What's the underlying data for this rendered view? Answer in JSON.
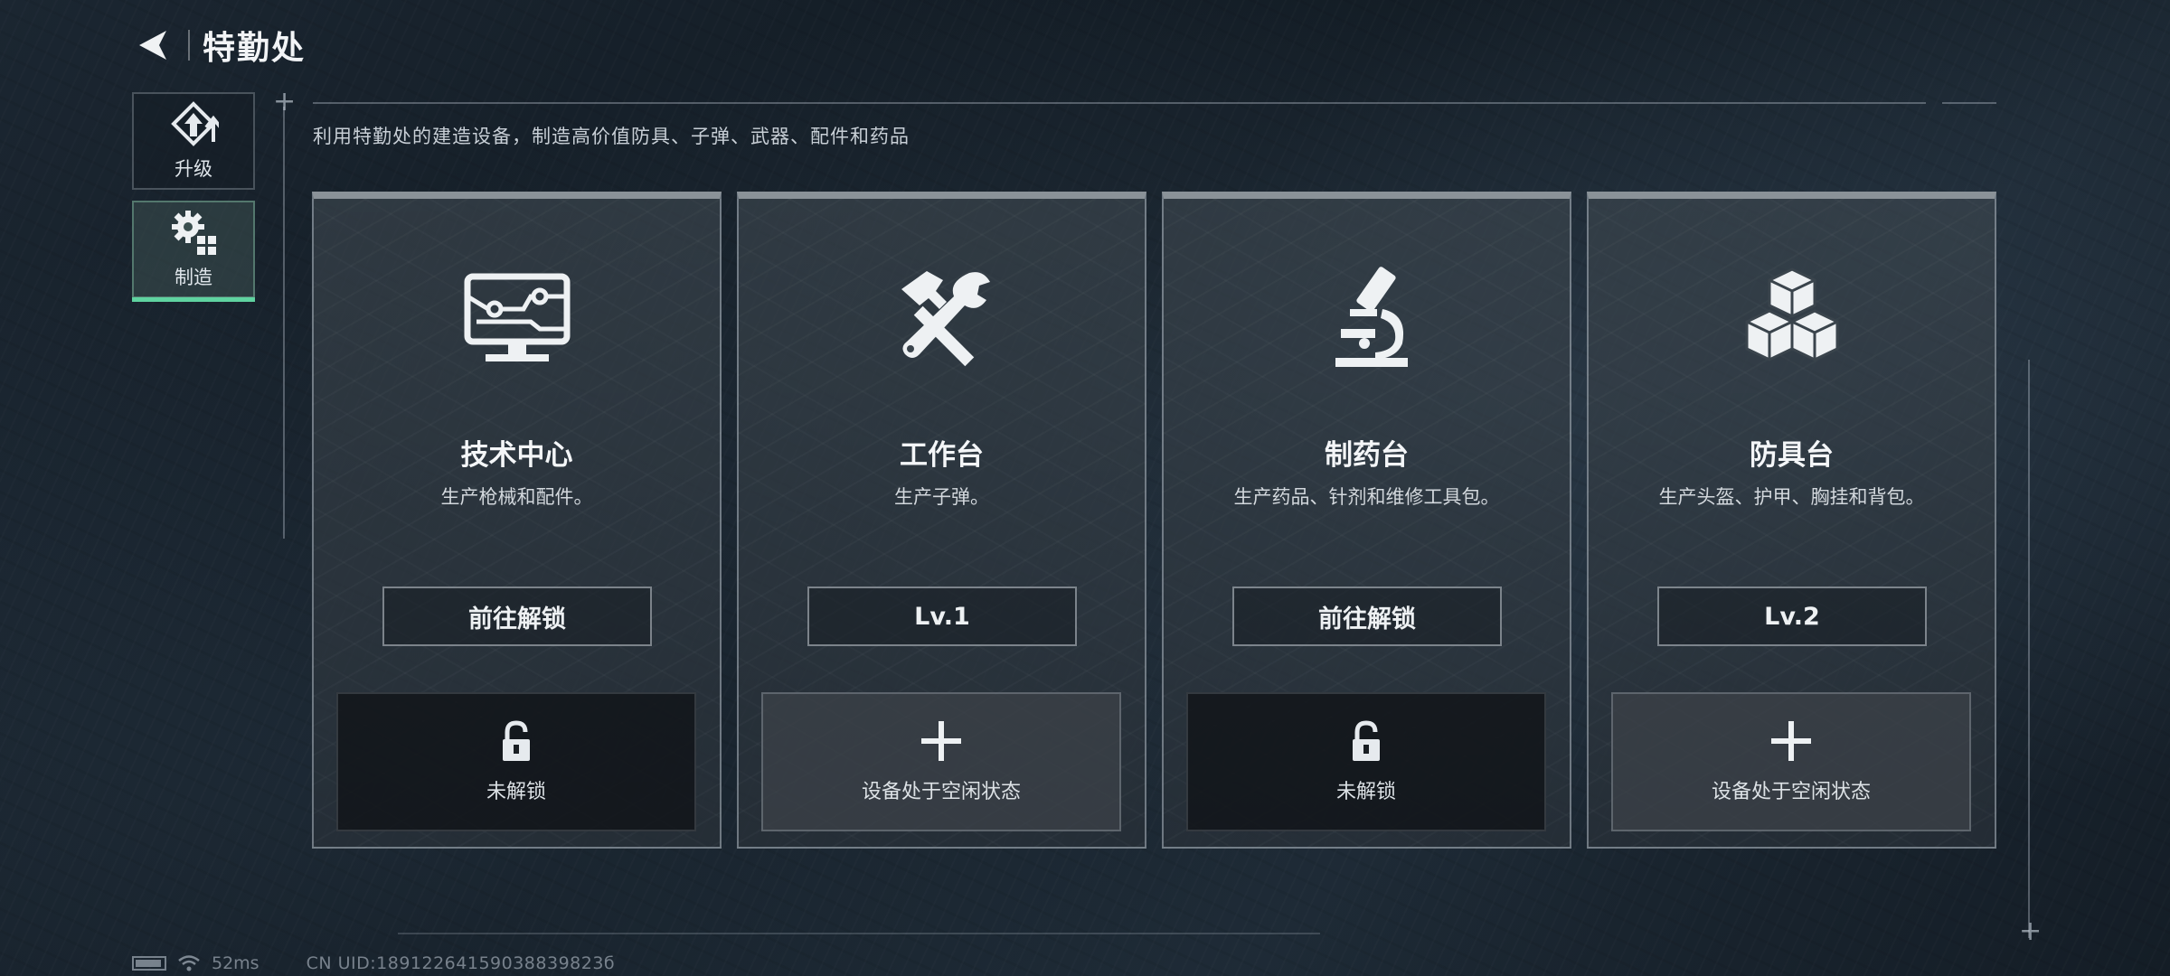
{
  "header": {
    "title": "特勤处"
  },
  "sidebar": {
    "items": [
      {
        "label": "升级",
        "icon": "upgrade-icon",
        "active": false
      },
      {
        "label": "制造",
        "icon": "gear-grid-icon",
        "active": true
      }
    ]
  },
  "subtitle": "利用特勤处的建造设备，制造高价值防具、子弹、武器、配件和药品",
  "stations": [
    {
      "name": "技术中心",
      "desc": "生产枪械和配件。",
      "icon": "monitor-circuit-icon",
      "button": "前往解锁",
      "slot_icon": "lock-icon",
      "slot_label": "未解锁",
      "slot_state": "locked"
    },
    {
      "name": "工作台",
      "desc": "生产子弹。",
      "icon": "hammer-wrench-icon",
      "button": "Lv.1",
      "slot_icon": "plus-icon",
      "slot_label": "设备处于空闲状态",
      "slot_state": "idle"
    },
    {
      "name": "制药台",
      "desc": "生产药品、针剂和维修工具包。",
      "icon": "microscope-icon",
      "button": "前往解锁",
      "slot_icon": "lock-icon",
      "slot_label": "未解锁",
      "slot_state": "locked"
    },
    {
      "name": "防具台",
      "desc": "生产头盔、护甲、胸挂和背包。",
      "icon": "boxes-icon",
      "button": "Lv.2",
      "slot_icon": "plus-icon",
      "slot_label": "设备处于空闲状态",
      "slot_state": "idle"
    }
  ],
  "footer": {
    "ping": "52ms",
    "uid": "CN UID:18912264159038839823б"
  },
  "colors": {
    "accent": "#5fd3a0",
    "card_top": "#8a9298"
  }
}
